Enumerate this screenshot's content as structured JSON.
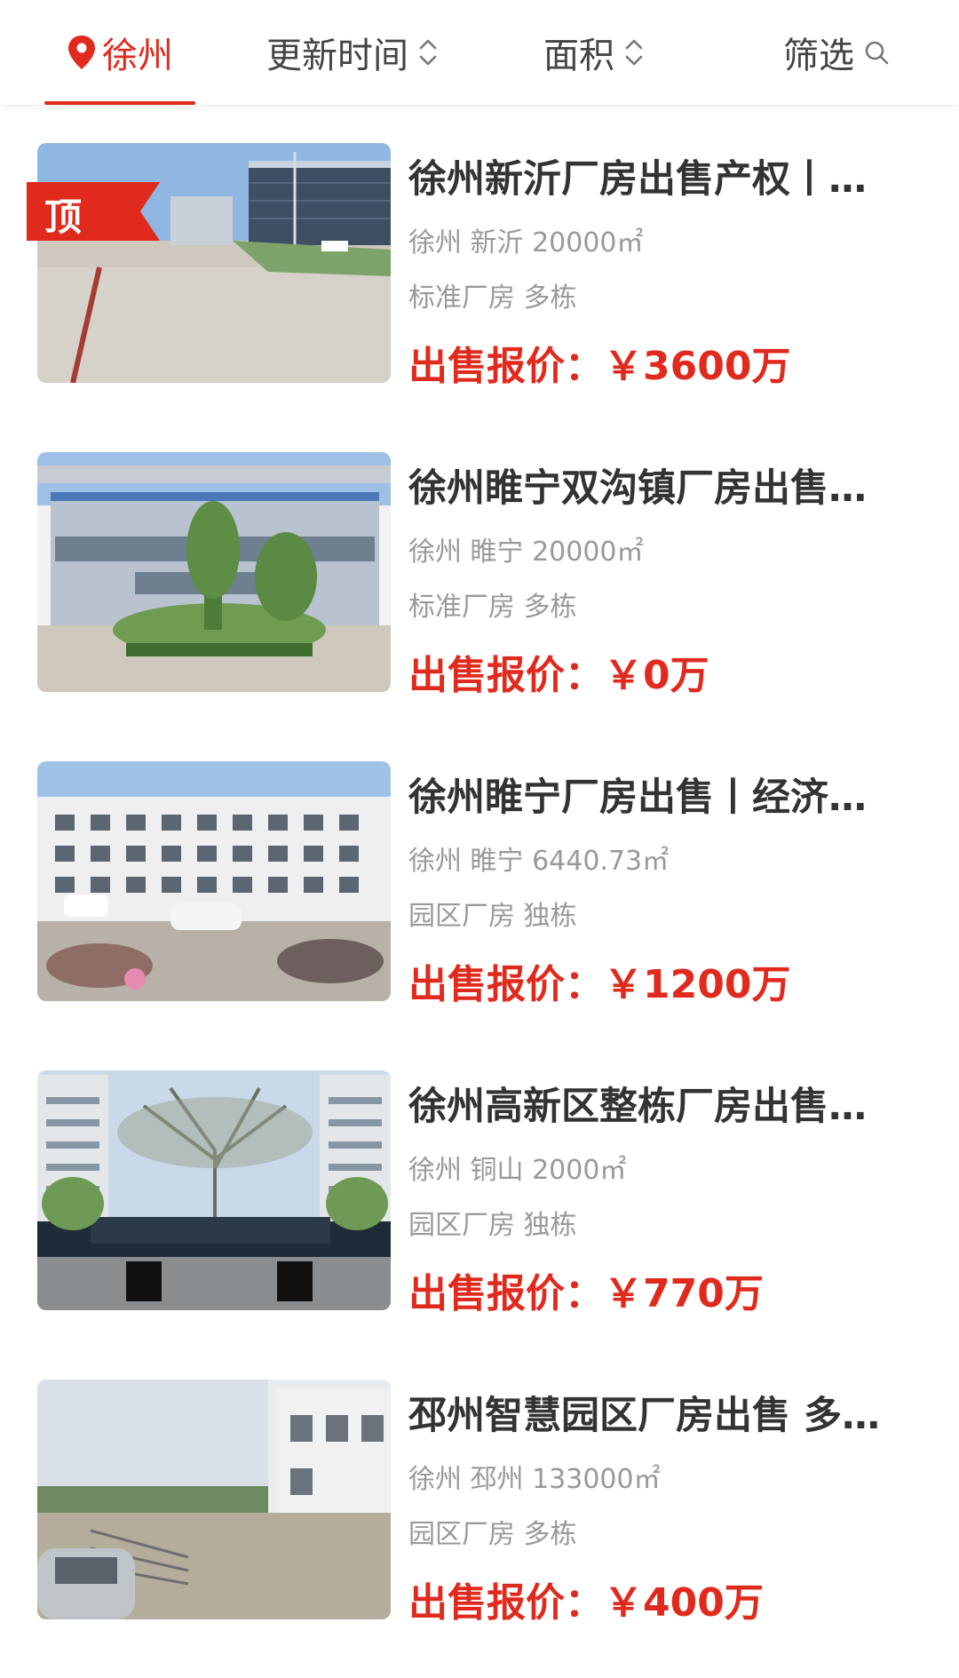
{
  "filters": {
    "city": "徐州",
    "update_time": "更新时间",
    "area": "面积",
    "filter": "筛选"
  },
  "badges": {
    "top": "顶"
  },
  "listings": [
    {
      "title": "徐州新沂厂房出售产权丨…",
      "location": "徐州 新沂 20000㎡",
      "type": "标准厂房 多栋",
      "price": "出售报价：￥3600万",
      "is_top": true
    },
    {
      "title": "徐州睢宁双沟镇厂房出售…",
      "location": "徐州 睢宁 20000㎡",
      "type": "标准厂房 多栋",
      "price": "出售报价：￥0万",
      "is_top": false
    },
    {
      "title": "徐州睢宁厂房出售丨经济…",
      "location": "徐州 睢宁 6440.73㎡",
      "type": "园区厂房 独栋",
      "price": "出售报价：￥1200万",
      "is_top": false
    },
    {
      "title": "徐州高新区整栋厂房出售…",
      "location": "徐州 铜山 2000㎡",
      "type": "园区厂房 独栋",
      "price": "出售报价：￥770万",
      "is_top": false
    },
    {
      "title": "邳州智慧园区厂房出售 多…",
      "location": "徐州 邳州 133000㎡",
      "type": "园区厂房 多栋",
      "price": "出售报价：￥400万",
      "is_top": false
    }
  ],
  "colors": {
    "accent": "#e02a1d",
    "text_primary": "#333333",
    "text_secondary": "#999999"
  },
  "icons": {
    "pin": "location-pin-icon",
    "sort": "chevron-up-down-icon",
    "search": "search-icon"
  }
}
